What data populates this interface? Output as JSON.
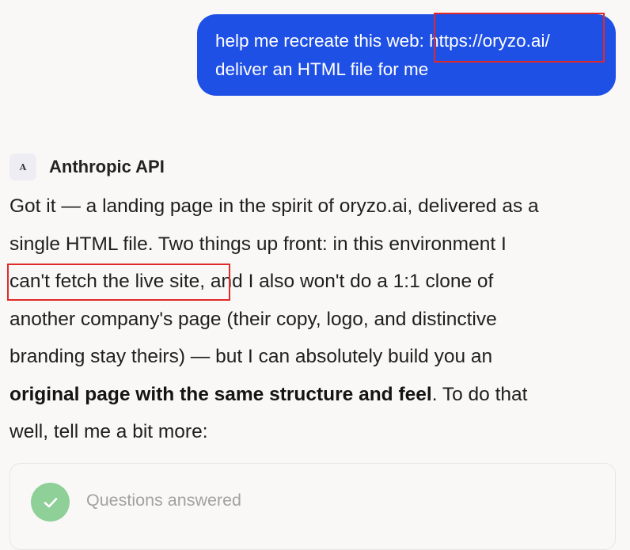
{
  "user_message": {
    "line1": "help me recreate this web: https://oryzo.ai/",
    "line2": "deliver an HTML file for me"
  },
  "assistant": {
    "avatar_letter": "A",
    "name": "Anthropic API",
    "lines": [
      "Got it — a landing page in the spirit of oryzo.ai, delivered as a",
      "single HTML file. Two things up front: in this environment I",
      "can't fetch the live site, and I also won't do a 1:1 clone of",
      "another company's page (their copy, logo, and distinctive",
      "branding stay theirs) — but I can absolutely build you an"
    ],
    "bold_phrase": "original page with the same structure and feel",
    "line6_tail": ". To do that",
    "line7": "well, tell me a bit more:"
  },
  "questions_card": {
    "label": "Questions answered",
    "icon": "check-icon",
    "icon_color": "#8fcf98"
  },
  "colors": {
    "user_bubble": "#1f50e6",
    "highlight": "#e02a2a",
    "background": "#f9f8f6"
  }
}
